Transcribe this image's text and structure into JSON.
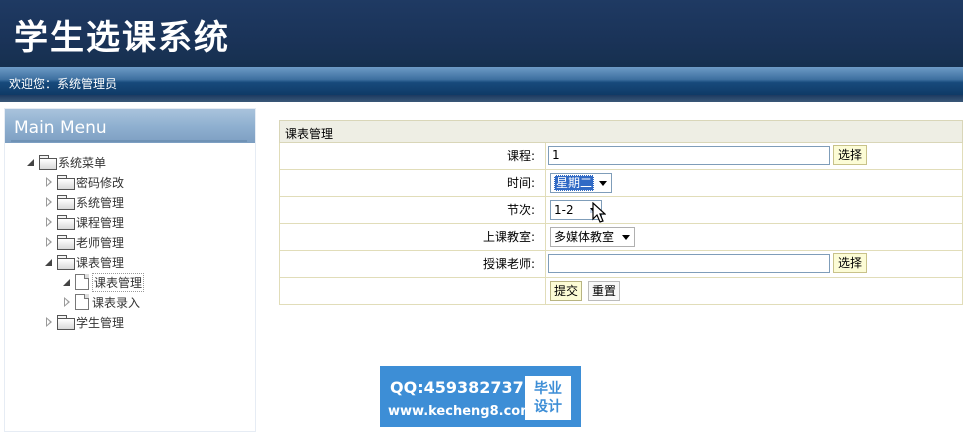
{
  "header": {
    "title": "学生选课系统",
    "welcome": "欢迎您：系统管理员"
  },
  "sidebar": {
    "menu_title": "Main Menu",
    "root": "系统菜单",
    "items": [
      {
        "label": "密码修改",
        "expanded": false
      },
      {
        "label": "系统管理",
        "expanded": false
      },
      {
        "label": "课程管理",
        "expanded": false
      },
      {
        "label": "老师管理",
        "expanded": false
      },
      {
        "label": "课表管理",
        "expanded": true
      },
      {
        "label": "课表管理",
        "expanded": false
      },
      {
        "label": "课表录入",
        "expanded": false
      },
      {
        "label": "学生管理",
        "expanded": false
      }
    ]
  },
  "form": {
    "title": "课表管理",
    "course_label": "课程:",
    "course_value": "1",
    "course_pick": "选择",
    "time_label": "时间:",
    "time_value": "星期二",
    "period_label": "节次:",
    "period_value": "1-2",
    "room_label": "上课教室:",
    "room_value": "多媒体教室",
    "teacher_label": "授课老师:",
    "teacher_value": "",
    "teacher_pick": "选择",
    "submit": "提交",
    "reset": "重置"
  },
  "watermark": {
    "qq": "QQ:459382737",
    "url": "www.kecheng8.com",
    "badge_line1": "毕业",
    "badge_line2": "设计"
  }
}
